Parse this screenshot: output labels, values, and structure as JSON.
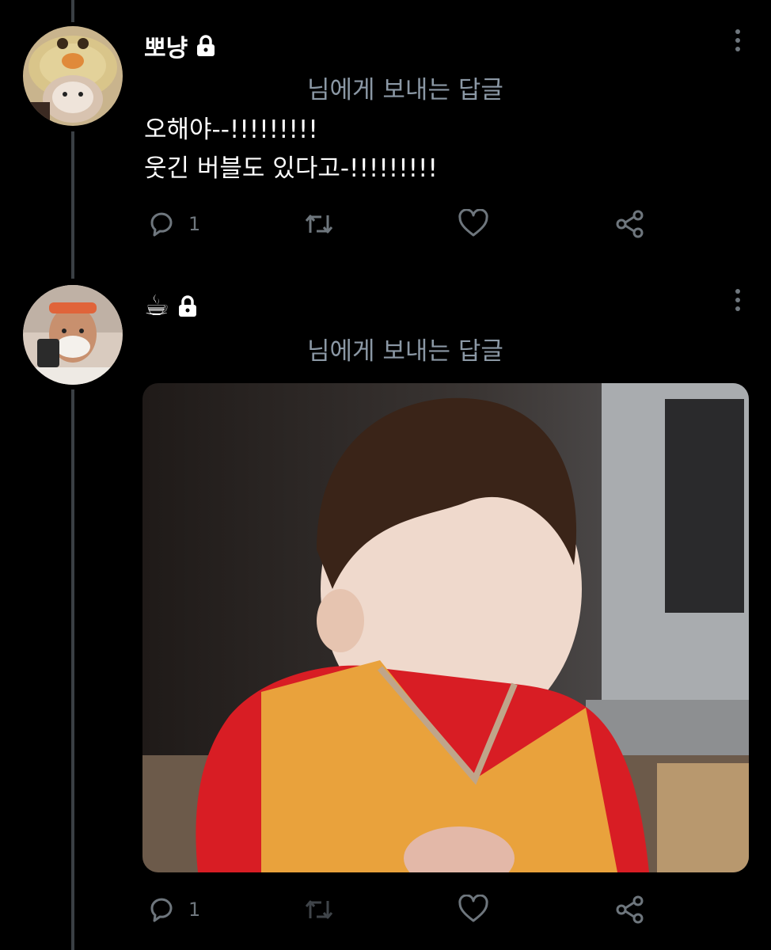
{
  "tweets": [
    {
      "author": "뽀냥",
      "reply_to": "님에게 보내는 답글",
      "lines": [
        "오해야--!!!!!!!!!",
        "웃긴 버블도 있다고-!!!!!!!!!"
      ],
      "reply_count": "1",
      "icons": [
        "reply-icon",
        "retweet-icon",
        "like-icon",
        "share-icon"
      ]
    },
    {
      "author": "☕",
      "reply_to": "님에게 보내는 답글",
      "reply_count": "1",
      "icons": [
        "reply-icon",
        "retweet-icon",
        "like-icon",
        "share-icon"
      ]
    }
  ],
  "colors": {
    "background": "#000000",
    "muted": "#8b98a5",
    "icon": "#6e767d",
    "thread": "#3a3f44"
  }
}
